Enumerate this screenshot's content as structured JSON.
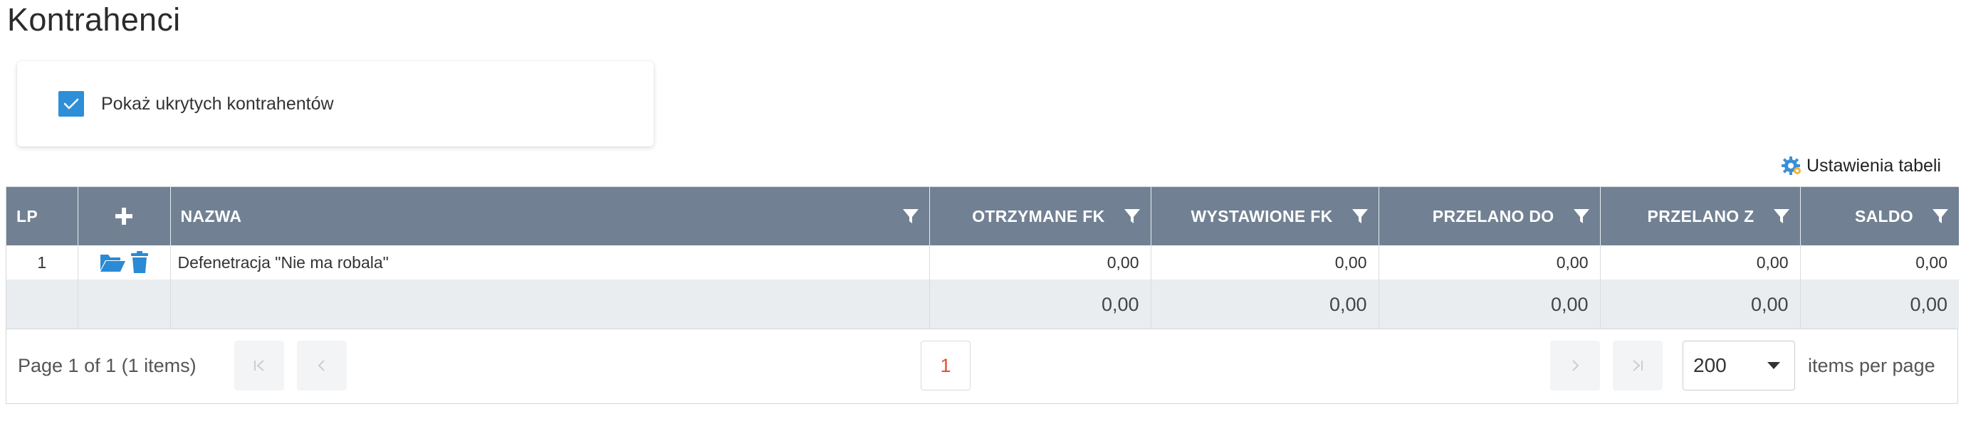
{
  "page": {
    "title": "Kontrahenci"
  },
  "filters": {
    "show_hidden_label": "Pokaż ukrytych kontrahentów",
    "show_hidden_checked": true
  },
  "toolbar": {
    "table_settings_label": "Ustawienia tabeli"
  },
  "table": {
    "columns": {
      "lp": "LP",
      "add": "+",
      "name": "NAZWA",
      "received": "OTRZYMANE FK",
      "issued": "WYSTAWIONE FK",
      "transfer_to": "PRZELANO DO",
      "transfer_from": "PRZELANO Z",
      "balance": "SALDO"
    },
    "rows": [
      {
        "lp": "1",
        "name": "Defenetracja \"Nie ma robala\"",
        "received": "0,00",
        "issued": "0,00",
        "transfer_to": "0,00",
        "transfer_from": "0,00",
        "balance": "0,00"
      }
    ],
    "totals": {
      "received": "0,00",
      "issued": "0,00",
      "transfer_to": "0,00",
      "transfer_from": "0,00",
      "balance": "0,00"
    }
  },
  "pager": {
    "info": "Page 1 of 1 (1 items)",
    "current_page": "1",
    "page_size": "200",
    "page_size_label": "items per page"
  },
  "colors": {
    "header_bg": "#718193",
    "accent_blue": "#2e8fd8",
    "current_page": "#e2522b",
    "totals_bg": "#e9edf0"
  }
}
